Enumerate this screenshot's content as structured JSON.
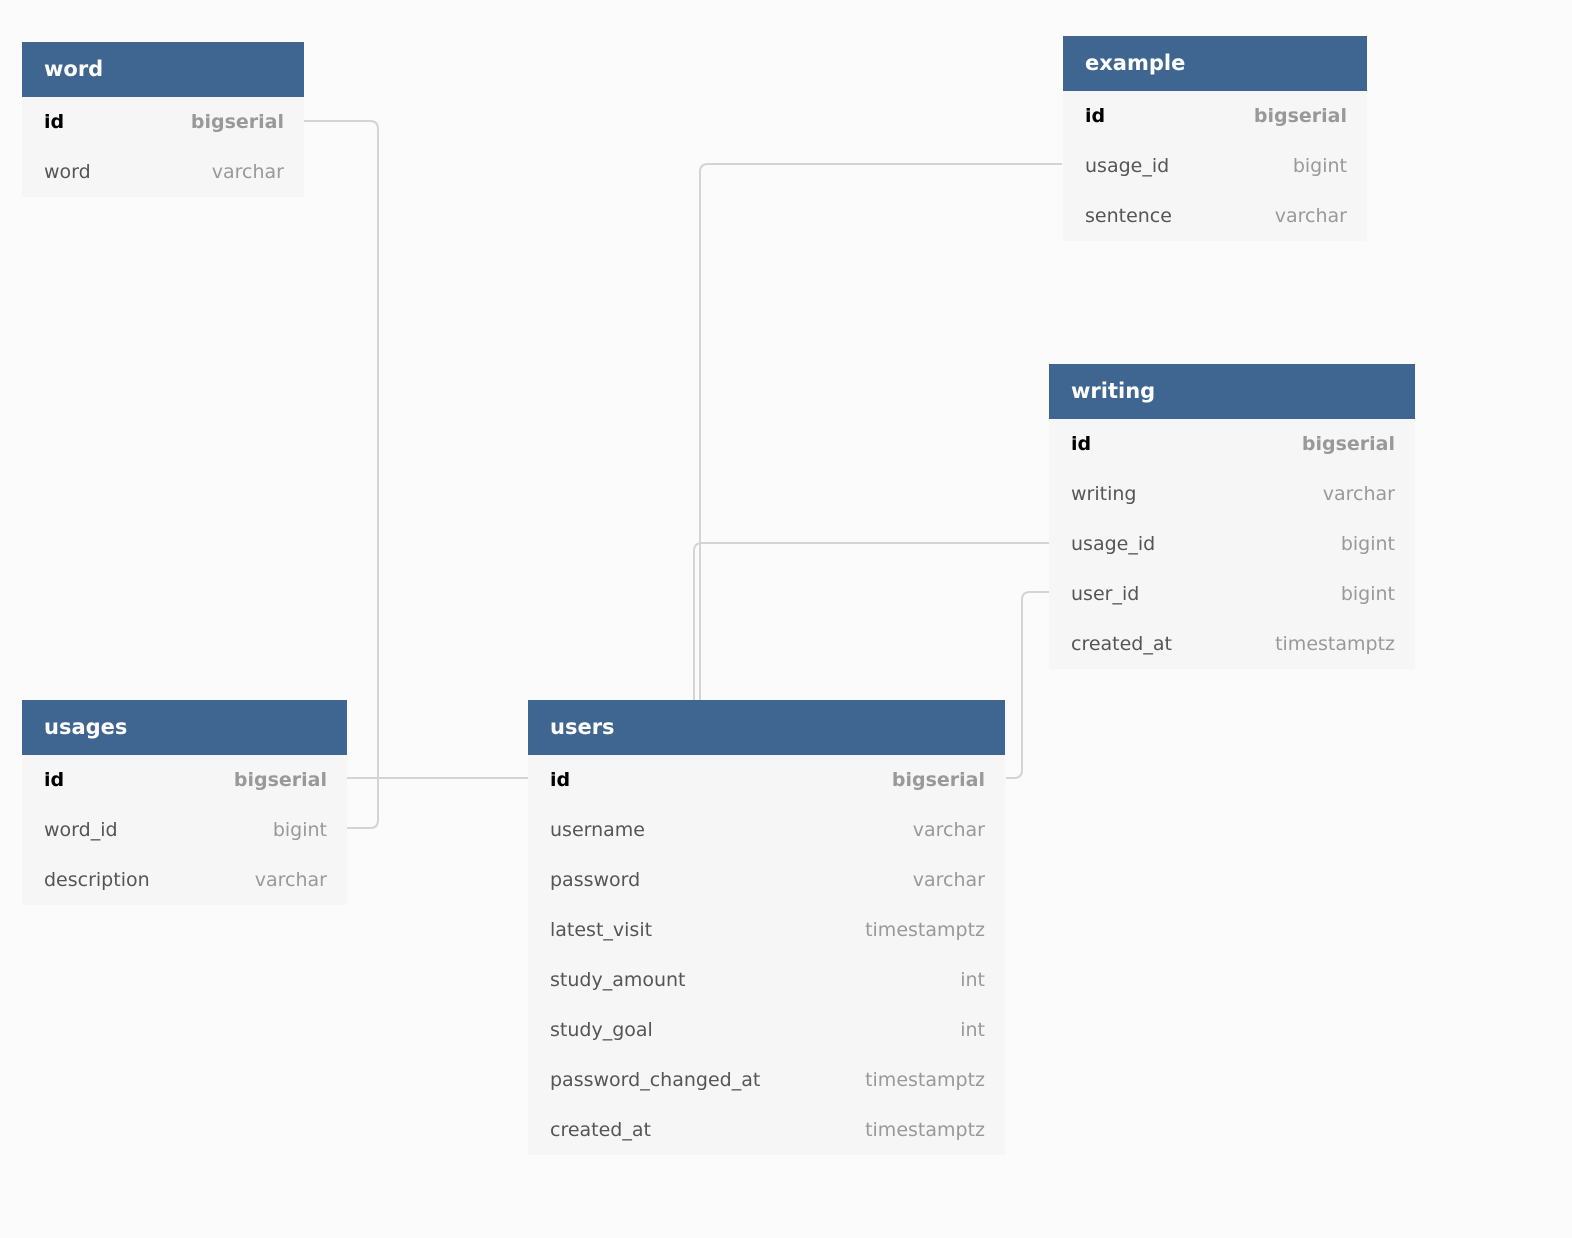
{
  "colors": {
    "header": "#3f6690",
    "body": "#f6f6f6",
    "background": "#fbfbfb",
    "link": "#d4d4d4"
  },
  "tables": {
    "word": {
      "name": "word",
      "columns": [
        {
          "name": "id",
          "type": "bigserial",
          "pk": true
        },
        {
          "name": "word",
          "type": "varchar"
        }
      ]
    },
    "example": {
      "name": "example",
      "columns": [
        {
          "name": "id",
          "type": "bigserial",
          "pk": true
        },
        {
          "name": "usage_id",
          "type": "bigint"
        },
        {
          "name": "sentence",
          "type": "varchar"
        }
      ]
    },
    "writing": {
      "name": "writing",
      "columns": [
        {
          "name": "id",
          "type": "bigserial",
          "pk": true
        },
        {
          "name": "writing",
          "type": "varchar"
        },
        {
          "name": "usage_id",
          "type": "bigint"
        },
        {
          "name": "user_id",
          "type": "bigint"
        },
        {
          "name": "created_at",
          "type": "timestamptz"
        }
      ]
    },
    "usages": {
      "name": "usages",
      "columns": [
        {
          "name": "id",
          "type": "bigserial",
          "pk": true
        },
        {
          "name": "word_id",
          "type": "bigint"
        },
        {
          "name": "description",
          "type": "varchar"
        }
      ]
    },
    "users": {
      "name": "users",
      "columns": [
        {
          "name": "id",
          "type": "bigserial",
          "pk": true
        },
        {
          "name": "username",
          "type": "varchar"
        },
        {
          "name": "password",
          "type": "varchar"
        },
        {
          "name": "latest_visit",
          "type": "timestamptz"
        },
        {
          "name": "study_amount",
          "type": "int"
        },
        {
          "name": "study_goal",
          "type": "int"
        },
        {
          "name": "password_changed_at",
          "type": "timestamptz"
        },
        {
          "name": "created_at",
          "type": "timestamptz"
        }
      ]
    }
  },
  "relations": [
    {
      "from": "usages.word_id",
      "to": "word.id"
    },
    {
      "from": "usages.id",
      "to": "users.id"
    },
    {
      "from": "example.usage_id",
      "to": "users"
    },
    {
      "from": "writing.usage_id",
      "to": "users"
    },
    {
      "from": "writing.user_id",
      "to": "users.id"
    }
  ]
}
